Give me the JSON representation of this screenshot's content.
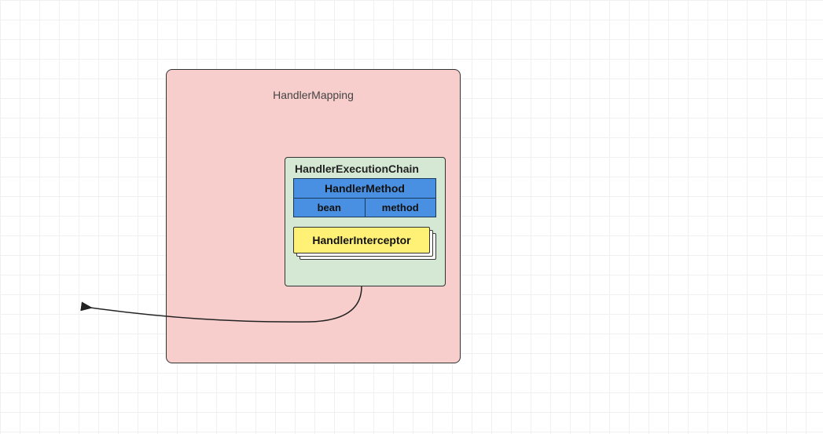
{
  "diagram": {
    "outerBox": {
      "title": "HandlerMapping"
    },
    "execChain": {
      "title": "HandlerExecutionChain"
    },
    "handlerMethod": {
      "title": "HandlerMethod",
      "cells": {
        "left": "bean",
        "right": "method"
      }
    },
    "interceptor": {
      "label": "HandlerInterceptor"
    }
  }
}
